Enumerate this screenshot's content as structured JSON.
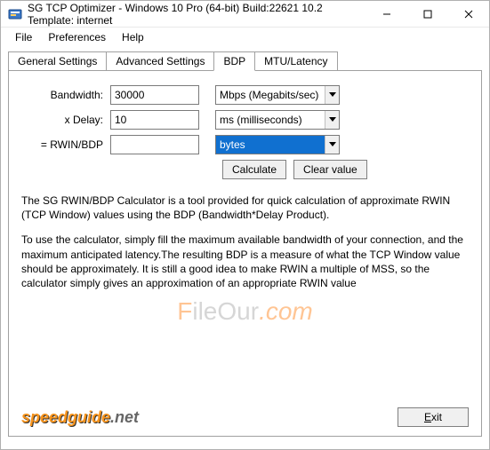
{
  "window": {
    "title": "SG TCP Optimizer - Windows 10 Pro (64-bit) Build:22621 10.2  Template: internet"
  },
  "menu": {
    "file": "File",
    "preferences": "Preferences",
    "help": "Help"
  },
  "tabs": {
    "general": "General Settings",
    "advanced": "Advanced Settings",
    "bdp": "BDP",
    "mtu": "MTU/Latency"
  },
  "form": {
    "bandwidth_label": "Bandwidth:",
    "bandwidth_value": "30000",
    "bandwidth_unit": "Mbps (Megabits/sec)",
    "delay_label": "x Delay:",
    "delay_value": "10",
    "delay_unit": "ms (milliseconds)",
    "rwin_label": "= RWIN/BDP",
    "rwin_value": "",
    "rwin_unit": "bytes"
  },
  "buttons": {
    "calculate": "Calculate",
    "clear": "Clear value",
    "exit": "Exit"
  },
  "description": {
    "p1": "The SG RWIN/BDP Calculator is a tool provided for quick calculation of approximate RWIN (TCP Window) values using the BDP (Bandwidth*Delay Product).",
    "p2": "To use the calculator, simply fill the maximum available bandwidth of your connection, and the maximum anticipated latency.The resulting BDP is a measure of what the TCP Window value should be approximately. It is still a good idea to make RWIN a multiple of MSS, so the calculator simply gives an approximation of an appropriate RWIN value"
  },
  "brand": {
    "part1": "speedguide",
    "part2": ".net"
  },
  "watermark": {
    "part1": "F",
    "part2": "ileOur",
    "part3": ".com"
  }
}
